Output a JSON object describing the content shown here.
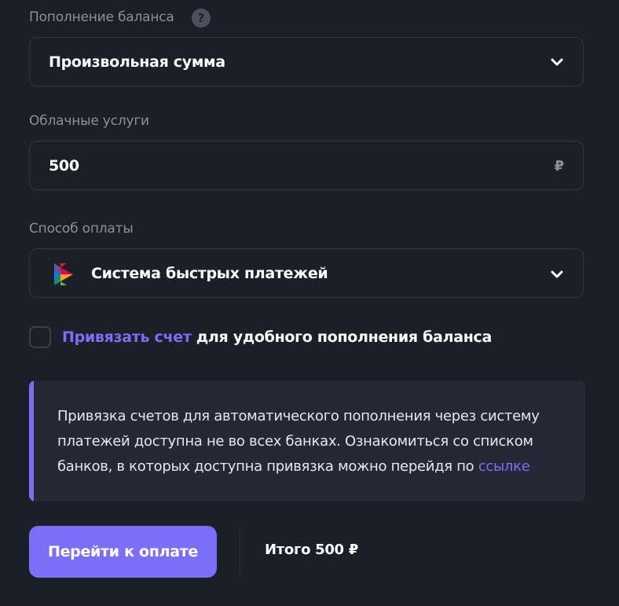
{
  "topup": {
    "label": "Пополнение баланса",
    "help_glyph": "?",
    "selected_amount_type": "Произвольная сумма"
  },
  "cloud": {
    "label": "Облачные услуги",
    "amount_value": "500",
    "currency": "₽"
  },
  "payment": {
    "label": "Способ оплаты",
    "method": "Система быстрых платежей",
    "method_icon": "sbp-logo-icon"
  },
  "consent": {
    "link_text": "Привязать счет",
    "rest_text": " для удобного пополнения баланса",
    "checked": false
  },
  "info": {
    "text": "Привязка счетов для автоматического пополнения через систему платежей доступна не во всех банках. Ознакомиться со списком банков, в которых доступна привязка можно перейдя по ",
    "link_text": "ссылке"
  },
  "footer": {
    "pay_label": "Перейти к оплате",
    "total_label": "Итого 500 ₽"
  },
  "colors": {
    "background": "#1b1f27",
    "accent": "#7b6ff7",
    "info_background": "#242a35",
    "muted_text": "#8a919d"
  }
}
